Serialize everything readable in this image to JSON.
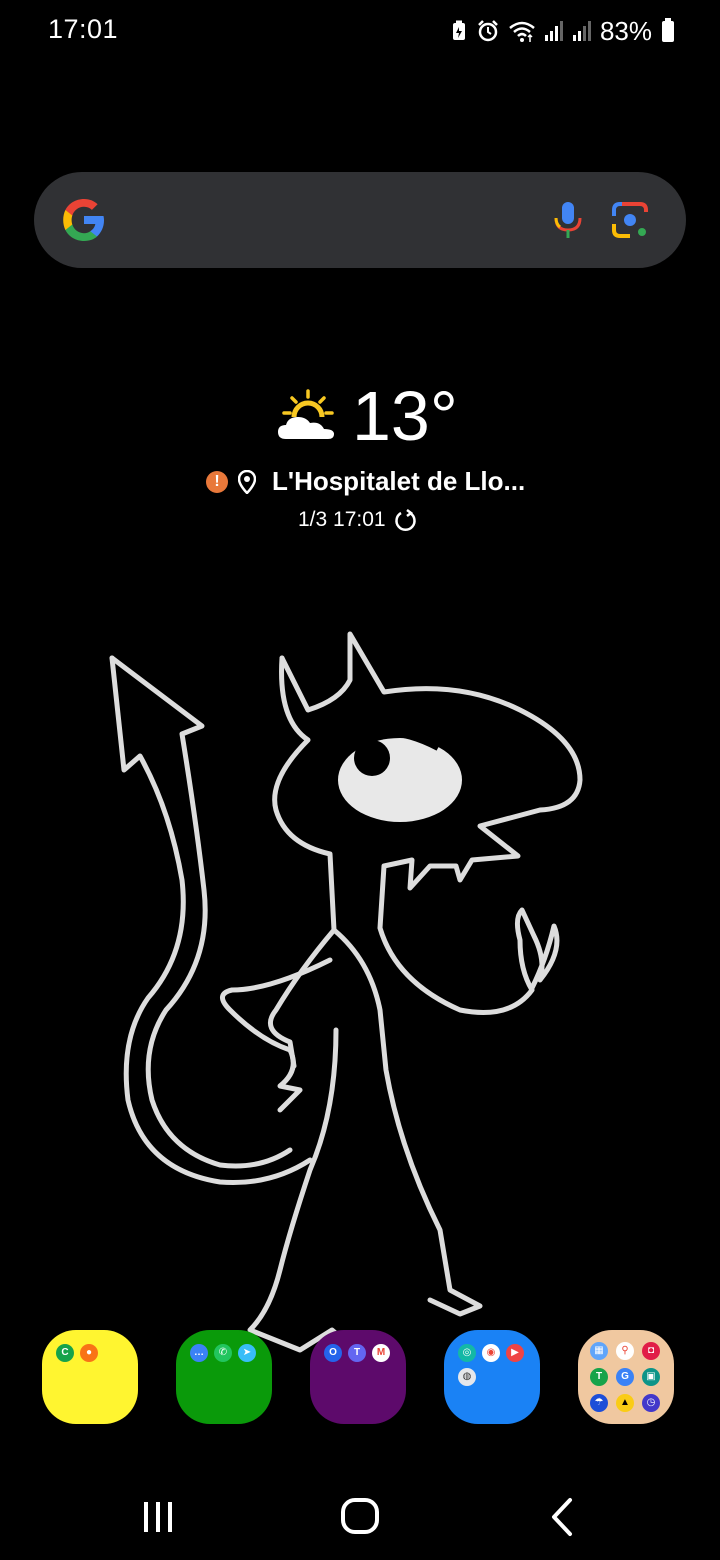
{
  "status_bar": {
    "time": "17:01",
    "battery": "83%",
    "icons": [
      "battery-saver-icon",
      "alarm-icon",
      "wifi-icon",
      "signal-icon",
      "signal-icon"
    ]
  },
  "search": {
    "icons": [
      "google-logo-icon",
      "mic-icon",
      "lens-icon"
    ]
  },
  "weather": {
    "temperature": "13°",
    "location": "L'Hospitalet de Llo...",
    "updated": "1/3 17:01",
    "icons": [
      "partly-cloudy-icon",
      "warning-icon",
      "location-pin-icon",
      "refresh-icon"
    ]
  },
  "dock": {
    "folders": [
      {
        "color": "#fff530",
        "apps": [
          "green-phone-app-icon",
          "orange-contacts-app-icon"
        ]
      },
      {
        "color": "#0a9a0a",
        "apps": [
          "messages-app-icon",
          "whatsapp-app-icon",
          "telegram-app-icon"
        ]
      },
      {
        "color": "#5d0a6b",
        "apps": [
          "outlook-app-icon",
          "teams-app-icon",
          "gmail-app-icon"
        ]
      },
      {
        "color": "#1a82f5",
        "apps": [
          "app-icon",
          "chrome-app-icon",
          "youtube-app-icon",
          "app-icon"
        ]
      },
      {
        "color": "#f0c8a0",
        "apps": [
          "maps-app-icon",
          "google-maps-app-icon",
          "camera-app-icon",
          "app-icon",
          "translate-app-icon",
          "app-icon",
          "weather-app-icon",
          "app-icon",
          "clock-app-icon"
        ]
      }
    ]
  },
  "nav": {
    "icons": [
      "recents-icon",
      "home-icon",
      "back-icon"
    ]
  }
}
